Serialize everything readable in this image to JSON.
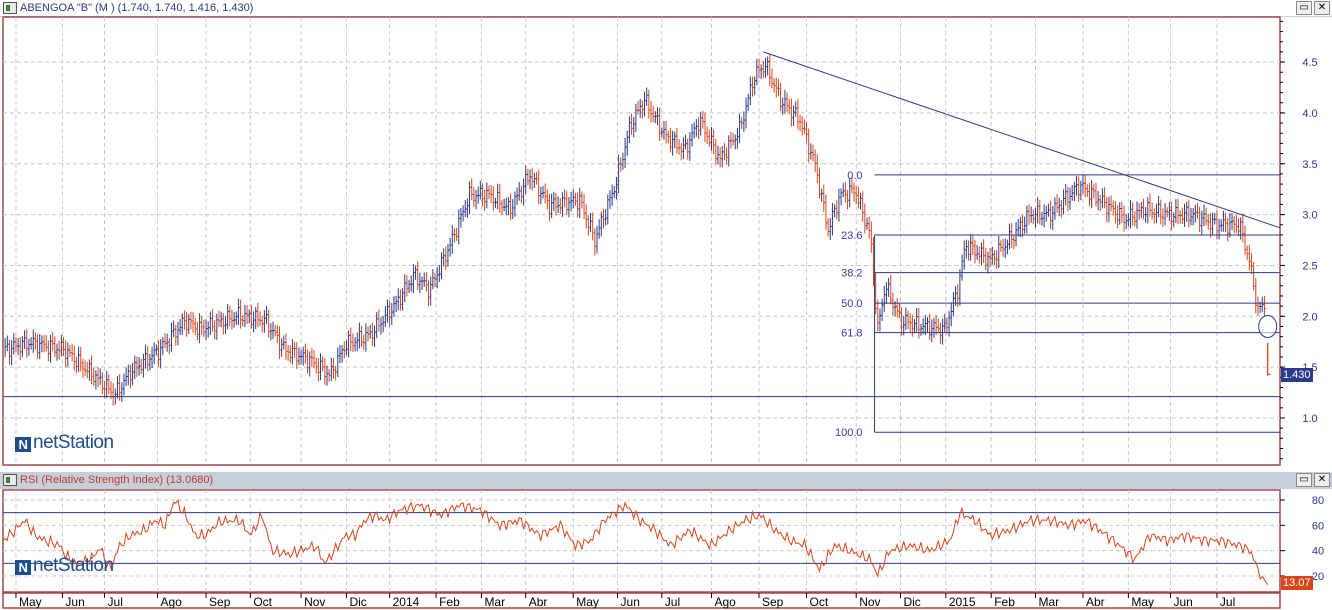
{
  "price_panel": {
    "title": "ABENGOA \"B\" (M ) (1.740, 1.740, 1.416, 1.430)",
    "last_price": "1.430",
    "logo": "netStation"
  },
  "rsi_panel": {
    "title": "RSI (Relative Strength Index) (13.0680)",
    "last_value": "13.07",
    "logo": "netStation"
  },
  "window_buttons": {
    "restore": "▭",
    "close": "✕"
  },
  "colors": {
    "up": "#2b3a8c",
    "down": "#d9461a",
    "line": "#2b3a8c",
    "frame": "#a04848",
    "rsi": "#d9461a"
  },
  "chart_data": [
    {
      "type": "ohlc",
      "title": "ABENGOA \"B\" (M )",
      "x_unit": "weeks since start",
      "xlim": [
        0,
        117.3
      ],
      "ylim": [
        0.5,
        4.9
      ],
      "yticks": [
        "1.0",
        "1.5",
        "2.0",
        "2.5",
        "3.0",
        "3.5",
        "4.0",
        "4.5"
      ],
      "grid": true,
      "closes": [
        [
          0,
          1.67
        ],
        [
          2.5,
          1.74
        ],
        [
          5.7,
          1.67
        ],
        [
          7.6,
          1.49
        ],
        [
          10.4,
          1.23
        ],
        [
          11.8,
          1.45
        ],
        [
          14.5,
          1.67
        ],
        [
          16.9,
          1.96
        ],
        [
          18.2,
          1.87
        ],
        [
          21.9,
          2.01
        ],
        [
          24.3,
          1.96
        ],
        [
          26.1,
          1.67
        ],
        [
          28.4,
          1.57
        ],
        [
          30.3,
          1.42
        ],
        [
          31.7,
          1.72
        ],
        [
          34,
          1.82
        ],
        [
          36.3,
          2.11
        ],
        [
          38.1,
          2.41
        ],
        [
          39.5,
          2.26
        ],
        [
          41.4,
          2.7
        ],
        [
          43.2,
          3.19
        ],
        [
          45.1,
          3.19
        ],
        [
          46.9,
          3.05
        ],
        [
          48.8,
          3.39
        ],
        [
          50.6,
          3.09
        ],
        [
          53.4,
          3.14
        ],
        [
          54.8,
          2.75
        ],
        [
          56.7,
          3.29
        ],
        [
          58.1,
          3.88
        ],
        [
          59.4,
          4.13
        ],
        [
          61.3,
          3.78
        ],
        [
          63.1,
          3.63
        ],
        [
          64.5,
          3.93
        ],
        [
          66.4,
          3.54
        ],
        [
          68.2,
          3.83
        ],
        [
          69.6,
          4.37
        ],
        [
          70.6,
          4.47
        ],
        [
          72,
          4.13
        ],
        [
          73.8,
          3.93
        ],
        [
          75.2,
          3.49
        ],
        [
          76.4,
          2.85
        ],
        [
          77.5,
          3.19
        ],
        [
          78.9,
          3.24
        ],
        [
          80.3,
          2.8
        ],
        [
          81,
          1.87
        ],
        [
          81.7,
          2.31
        ],
        [
          83.1,
          1.96
        ],
        [
          84.9,
          1.91
        ],
        [
          87.2,
          1.87
        ],
        [
          88.4,
          2.26
        ],
        [
          89.1,
          2.7
        ],
        [
          91.4,
          2.55
        ],
        [
          93.2,
          2.75
        ],
        [
          95.1,
          3.0
        ],
        [
          96.9,
          3.0
        ],
        [
          99.7,
          3.29
        ],
        [
          101.6,
          3.14
        ],
        [
          103.9,
          2.95
        ],
        [
          105.7,
          3.05
        ],
        [
          108,
          3.0
        ],
        [
          110.3,
          3.0
        ],
        [
          112.2,
          2.9
        ],
        [
          114.5,
          2.9
        ],
        [
          115.4,
          2.55
        ],
        [
          116.2,
          2.06
        ],
        [
          116.8,
          2.11
        ],
        [
          117.1,
          1.43
        ]
      ],
      "last_bar": {
        "open": 1.74,
        "high": 1.74,
        "low": 1.416,
        "close": 1.43
      },
      "trendline": [
        [
          70.4,
          4.6
        ],
        [
          118.2,
          2.87
        ]
      ],
      "support_line": 1.21,
      "fibonacci": {
        "start_t": 80.7,
        "levels": [
          {
            "label": "0.0",
            "price": 3.39
          },
          {
            "label": "23.6",
            "price": 2.8
          },
          {
            "label": "38.2",
            "price": 2.43
          },
          {
            "label": "50.0",
            "price": 2.13
          },
          {
            "label": "61.8",
            "price": 1.84
          },
          {
            "label": "100.0",
            "price": 0.86
          }
        ]
      },
      "circle_marker": {
        "t": 117.1,
        "price": 1.9
      }
    },
    {
      "type": "line",
      "title": "RSI (Relative Strength Index)",
      "ylim": [
        10,
        87
      ],
      "yticks": [
        "20",
        "40",
        "60",
        "80"
      ],
      "levels": [
        30,
        70
      ],
      "points": [
        [
          0,
          48
        ],
        [
          1.1,
          56
        ],
        [
          2,
          64
        ],
        [
          3,
          52
        ],
        [
          3.9,
          48
        ],
        [
          5.3,
          44
        ],
        [
          5.7,
          37
        ],
        [
          6.7,
          29
        ],
        [
          8.1,
          33
        ],
        [
          9,
          42
        ],
        [
          9.9,
          25
        ],
        [
          10.8,
          44
        ],
        [
          11.8,
          52
        ],
        [
          13.1,
          56
        ],
        [
          14.1,
          64
        ],
        [
          15,
          60
        ],
        [
          15.9,
          80
        ],
        [
          16.9,
          68
        ],
        [
          17.8,
          52
        ],
        [
          18.7,
          52
        ],
        [
          20.1,
          63
        ],
        [
          21.9,
          64
        ],
        [
          22.9,
          52
        ],
        [
          24,
          68
        ],
        [
          24.9,
          40
        ],
        [
          26.6,
          37
        ],
        [
          27.5,
          40
        ],
        [
          28.9,
          44
        ],
        [
          29.8,
          30
        ],
        [
          30.7,
          40
        ],
        [
          31.7,
          52
        ],
        [
          32.6,
          52
        ],
        [
          33.5,
          64
        ],
        [
          34.4,
          68
        ],
        [
          35.4,
          64
        ],
        [
          36.8,
          72
        ],
        [
          38.6,
          76
        ],
        [
          40.5,
          68
        ],
        [
          42.3,
          76
        ],
        [
          44.2,
          72
        ],
        [
          46,
          60
        ],
        [
          47.9,
          64
        ],
        [
          49.7,
          52
        ],
        [
          51.6,
          60
        ],
        [
          53,
          44
        ],
        [
          54.4,
          48
        ],
        [
          55.7,
          64
        ],
        [
          57.6,
          76
        ],
        [
          59,
          64
        ],
        [
          60.4,
          56
        ],
        [
          61.8,
          44
        ],
        [
          63.6,
          56
        ],
        [
          65.5,
          44
        ],
        [
          67.3,
          56
        ],
        [
          68.7,
          64
        ],
        [
          70.1,
          68
        ],
        [
          71.5,
          56
        ],
        [
          72.9,
          48
        ],
        [
          74.3,
          44
        ],
        [
          75.6,
          25
        ],
        [
          77,
          44
        ],
        [
          78.4,
          40
        ],
        [
          80.3,
          33
        ],
        [
          81,
          21
        ],
        [
          82.1,
          40
        ],
        [
          84,
          44
        ],
        [
          85.8,
          40
        ],
        [
          87.7,
          48
        ],
        [
          88.6,
          70
        ],
        [
          90,
          64
        ],
        [
          91.4,
          52
        ],
        [
          93.2,
          56
        ],
        [
          95.1,
          64
        ],
        [
          96.9,
          64
        ],
        [
          98.8,
          60
        ],
        [
          100.2,
          64
        ],
        [
          101.6,
          56
        ],
        [
          103.4,
          44
        ],
        [
          104.8,
          33
        ],
        [
          106.2,
          52
        ],
        [
          108,
          48
        ],
        [
          109.4,
          52
        ],
        [
          111.3,
          48
        ],
        [
          112.7,
          48
        ],
        [
          114.5,
          44
        ],
        [
          115.5,
          40
        ],
        [
          116.2,
          25
        ],
        [
          117.1,
          13.07
        ]
      ]
    }
  ],
  "x_axis": [
    {
      "label": "May",
      "t": 1.2
    },
    {
      "label": "Jun",
      "t": 5.5
    },
    {
      "label": "Jul",
      "t": 9.4
    },
    {
      "label": "Ago",
      "t": 14.3
    },
    {
      "label": "Sep",
      "t": 18.8
    },
    {
      "label": "Oct",
      "t": 22.9
    },
    {
      "label": "Nov",
      "t": 27.6
    },
    {
      "label": "Dic",
      "t": 31.8
    },
    {
      "label": "2014",
      "t": 35.8
    },
    {
      "label": "Feb",
      "t": 40.1
    },
    {
      "label": "Mar",
      "t": 44.3
    },
    {
      "label": "Abr",
      "t": 48.4
    },
    {
      "label": "May",
      "t": 52.8
    },
    {
      "label": "Jun",
      "t": 56.9
    },
    {
      "label": "Jul",
      "t": 61
    },
    {
      "label": "Ago",
      "t": 65.6
    },
    {
      "label": "Sep",
      "t": 70
    },
    {
      "label": "Oct",
      "t": 74.4
    },
    {
      "label": "Nov",
      "t": 79
    },
    {
      "label": "Dic",
      "t": 83.1
    },
    {
      "label": "2015",
      "t": 87.3
    },
    {
      "label": "Feb",
      "t": 91.5
    },
    {
      "label": "Mar",
      "t": 95.6
    },
    {
      "label": "Abr",
      "t": 100
    },
    {
      "label": "May",
      "t": 104.2
    },
    {
      "label": "Jun",
      "t": 108.1
    },
    {
      "label": "Jul",
      "t": 112.4
    }
  ]
}
